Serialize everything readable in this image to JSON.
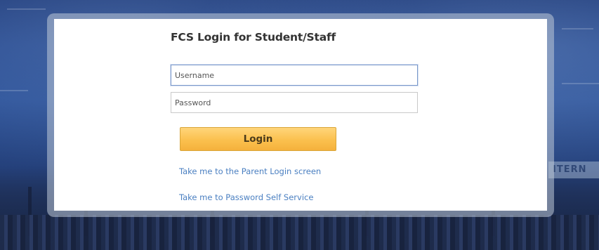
{
  "login": {
    "title": "FCS Login for Student/Staff",
    "username_placeholder": "Username",
    "username_value": "",
    "password_placeholder": "Password",
    "password_value": "",
    "login_button": "Login"
  },
  "links": {
    "parent_login": "Take me to the Parent Login screen",
    "password_self_service": "Take me to Password Self Service"
  },
  "background": {
    "sign_text": "ITERN"
  },
  "colors": {
    "button_top": "#ffd57a",
    "button_bottom": "#f5b13c",
    "link": "#4a7fc1",
    "panel": "#ffffff",
    "background": "#2c5299"
  }
}
